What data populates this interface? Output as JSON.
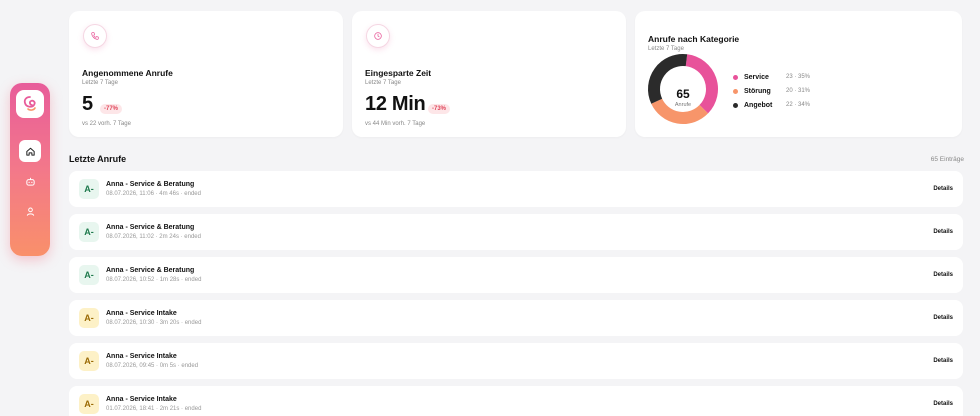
{
  "sidebar": {
    "items": [
      {
        "name": "home",
        "active": true
      },
      {
        "name": "robot",
        "active": false
      },
      {
        "name": "user",
        "active": false
      }
    ]
  },
  "cards": {
    "accepted": {
      "title": "Angenommene Anrufe",
      "period": "Letzte 7 Tage",
      "value": "5",
      "delta": "-77%",
      "compare": "vs 22 vorh. 7 Tage"
    },
    "saved": {
      "title": "Eingesparte Zeit",
      "period": "Letzte 7 Tage",
      "value": "12 Min",
      "delta": "-73%",
      "compare": "vs 44 Min vorh. 7 Tage"
    },
    "category": {
      "title": "Anrufe nach Kategorie",
      "period": "Letzte 7 Tage",
      "center_value": "65",
      "center_label": "Anrufe"
    }
  },
  "chart_data": {
    "type": "pie",
    "categories": [
      "Service",
      "Störung",
      "Angebot"
    ],
    "values": [
      23,
      20,
      22
    ],
    "labels": [
      "23 · 35%",
      "20 · 31%",
      "22 · 34%"
    ],
    "colors": [
      "#e8529a",
      "#f7956a",
      "#2b2b2b"
    ]
  },
  "recent": {
    "title": "Letzte Anrufe",
    "count": "65 Einträge",
    "details_label": "Details",
    "rows": [
      {
        "grade": "A-",
        "tone": "g",
        "title": "Anna - Service & Beratung",
        "meta": "08.07.2026, 11:06 · 4m 46s · ended"
      },
      {
        "grade": "A-",
        "tone": "g",
        "title": "Anna - Service & Beratung",
        "meta": "08.07.2026, 11:02 · 2m 24s · ended"
      },
      {
        "grade": "A-",
        "tone": "g",
        "title": "Anna - Service & Beratung",
        "meta": "08.07.2026, 10:52 · 1m 28s · ended"
      },
      {
        "grade": "A-",
        "tone": "y",
        "title": "Anna - Service Intake",
        "meta": "08.07.2026, 10:30 · 3m 20s · ended"
      },
      {
        "grade": "A-",
        "tone": "y",
        "title": "Anna - Service Intake",
        "meta": "08.07.2026, 09:45 · 0m 5s · ended"
      },
      {
        "grade": "A-",
        "tone": "y",
        "title": "Anna - Service Intake",
        "meta": "01.07.2026, 18:41 · 2m 21s · ended"
      }
    ]
  }
}
